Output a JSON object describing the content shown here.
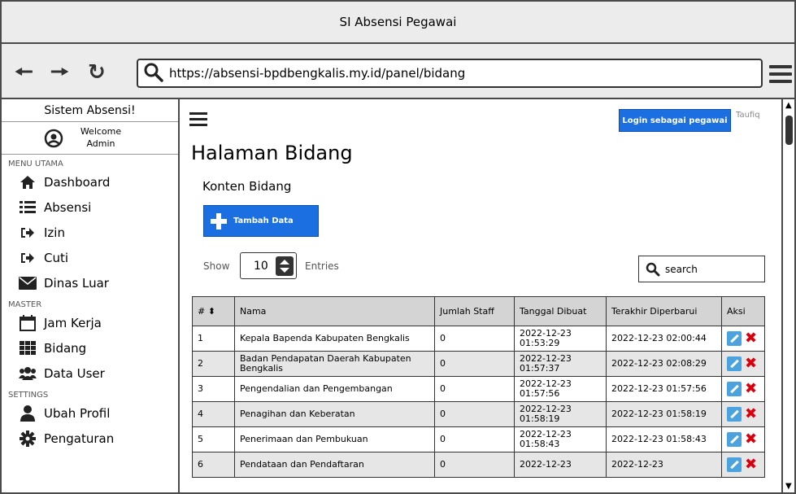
{
  "window": {
    "title": "SI Absensi Pegawai"
  },
  "browser": {
    "url": "https://absensi-bpdbengkalis.my.id/panel/bidang",
    "back_icon": "arrow-left-icon",
    "forward_icon": "arrow-right-icon",
    "reload_icon": "reload-icon",
    "menu_icon": "hamburger-icon"
  },
  "sidebar": {
    "title": "Sistem Absensi!",
    "welcome": "Welcome",
    "user": "Admin",
    "sections": [
      {
        "label": "MENU UTAMA",
        "items": [
          {
            "label": "Dashboard",
            "icon": "home-icon"
          },
          {
            "label": "Absensi",
            "icon": "list-icon"
          },
          {
            "label": "Izin",
            "icon": "sign-in-icon"
          },
          {
            "label": "Cuti",
            "icon": "sign-in-icon"
          },
          {
            "label": "Dinas Luar",
            "icon": "envelope-icon"
          }
        ]
      },
      {
        "label": "MASTER",
        "items": [
          {
            "label": "Jam Kerja",
            "icon": "calendar-icon"
          },
          {
            "label": "Bidang",
            "icon": "grid-icon"
          },
          {
            "label": "Data User",
            "icon": "users-icon"
          }
        ]
      },
      {
        "label": "SETTINGS",
        "items": [
          {
            "label": "Ubah Profil",
            "icon": "user-icon"
          },
          {
            "label": "Pengaturan",
            "icon": "gear-icon"
          }
        ]
      }
    ]
  },
  "header": {
    "login_button": "Login sebagai pegawai",
    "username": "Taufiq"
  },
  "main": {
    "title": "Halaman Bidang",
    "subtitle": "Konten Bidang",
    "add_button": "Tambah Data",
    "show_label": "Show",
    "entries_value": "10",
    "entries_label": "Entries",
    "search_placeholder": "search"
  },
  "table": {
    "columns": [
      "#",
      "Nama",
      "Jumlah Staff",
      "Tanggal Dibuat",
      "Terakhir Diperbarui",
      "Aksi"
    ],
    "rows": [
      {
        "no": "1",
        "nama": "Kepala Bapenda Kabupaten Bengkalis",
        "jumlah": "0",
        "dibuat": "2022-12-23 01:53:29",
        "diperbarui": "2022-12-23 02:00:44"
      },
      {
        "no": "2",
        "nama": "Badan Pendapatan Daerah Kabupaten Bengkalis",
        "jumlah": "0",
        "dibuat": "2022-12-23 01:57:37",
        "diperbarui": "2022-12-23 02:08:29"
      },
      {
        "no": "3",
        "nama": "Pengendalian dan Pengembangan",
        "jumlah": "0",
        "dibuat": "2022-12-23 01:57:56",
        "diperbarui": "2022-12-23 01:57:56"
      },
      {
        "no": "4",
        "nama": "Penagihan dan Keberatan",
        "jumlah": "0",
        "dibuat": "2022-12-23 01:58:19",
        "diperbarui": "2022-12-23 01:58:19"
      },
      {
        "no": "5",
        "nama": "Penerimaan dan Pembukuan",
        "jumlah": "0",
        "dibuat": "2022-12-23 01:58:43",
        "diperbarui": "2022-12-23 01:58:43"
      },
      {
        "no": "6",
        "nama": "Pendataan dan Pendaftaran",
        "jumlah": "0",
        "dibuat": "2022-12-23",
        "diperbarui": "2022-12-23"
      }
    ]
  },
  "colors": {
    "primary": "#1b6fe0",
    "danger": "#d9000d",
    "edit": "#4aa3df",
    "chrome": "#ececec"
  }
}
